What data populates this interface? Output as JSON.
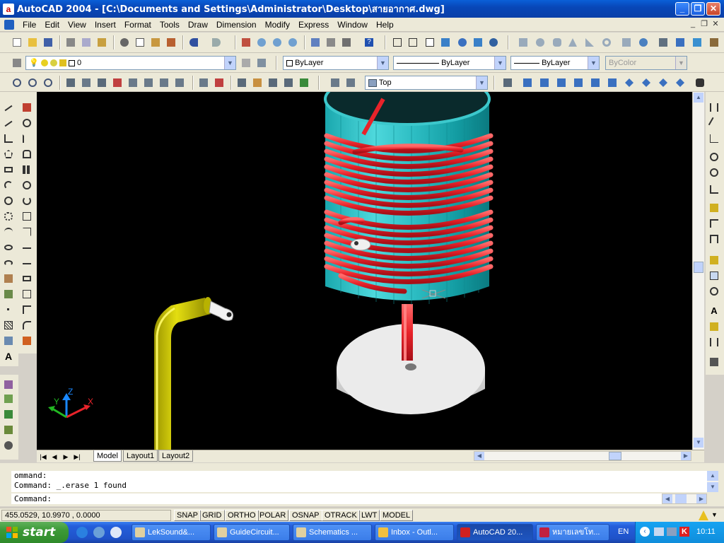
{
  "window": {
    "title": "AutoCAD 2004 - [C:\\Documents and Settings\\Administrator\\Desktop\\สายอากาศ.dwg]",
    "app_icon_letter": "a",
    "minimize": "_",
    "maximize": "❐",
    "close": "✕"
  },
  "menubar": {
    "items": [
      "File",
      "Edit",
      "View",
      "Insert",
      "Format",
      "Tools",
      "Draw",
      "Dimension",
      "Modify",
      "Express",
      "Window",
      "Help"
    ]
  },
  "toolbars": {
    "layer_value": "0",
    "color_value": "ByLayer",
    "linetype_value": "ByLayer",
    "lineweight_value": "ByLayer",
    "plotstyle_value": "ByColor",
    "view_value": "Top"
  },
  "layout_tabs": [
    "Model",
    "Layout1",
    "Layout2"
  ],
  "ucs": {
    "x": "X",
    "y": "Y",
    "z": "Z"
  },
  "command_window": {
    "line1": "ommand:",
    "line2": "Command: _.erase 1 found",
    "prompt": "Command:"
  },
  "statusbar": {
    "coordinates": "455.0529, 10.9970 , 0.0000",
    "buttons": [
      "SNAP",
      "GRID",
      "ORTHO",
      "POLAR",
      "OSNAP",
      "OTRACK",
      "LWT",
      "MODEL"
    ]
  },
  "taskbar": {
    "start_label": "start",
    "tasks": [
      "LekSound&...",
      "GuideCircuit...",
      "Schematics ...",
      "Inbox - Outl...",
      "AutoCAD 20...",
      "หมายเลขโท..."
    ],
    "language": "EN",
    "clock": "10:11"
  },
  "colors": {
    "coil": "#e8232a",
    "cylinder": "#3cc8cc",
    "pipe": "#c8c200",
    "base": "#e8e8e8",
    "viewport_bg": "#000000"
  }
}
